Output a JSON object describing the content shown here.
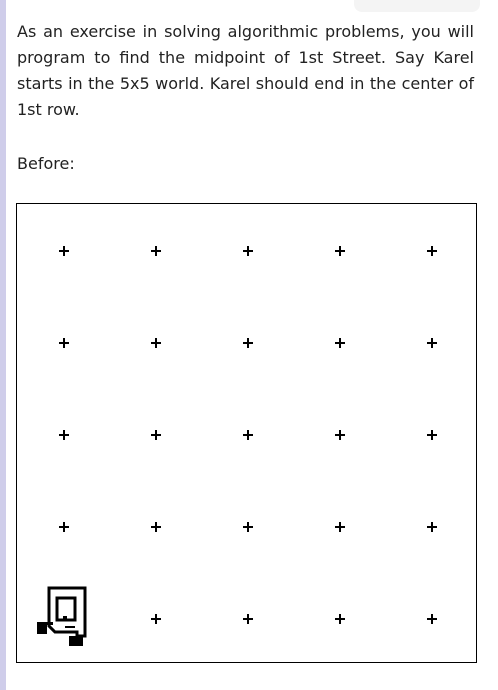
{
  "instructions": {
    "text": "As an exercise in solving algorithmic problems, you will program to find the midpoint of 1st Street. Say Karel starts in the 5x5 world. Karel should end in the center of 1st row."
  },
  "before_label": "Before:",
  "world": {
    "rows": 5,
    "cols": 5,
    "karel": {
      "street": 1,
      "avenue": 1,
      "icon": "karel-robot-icon"
    }
  }
}
